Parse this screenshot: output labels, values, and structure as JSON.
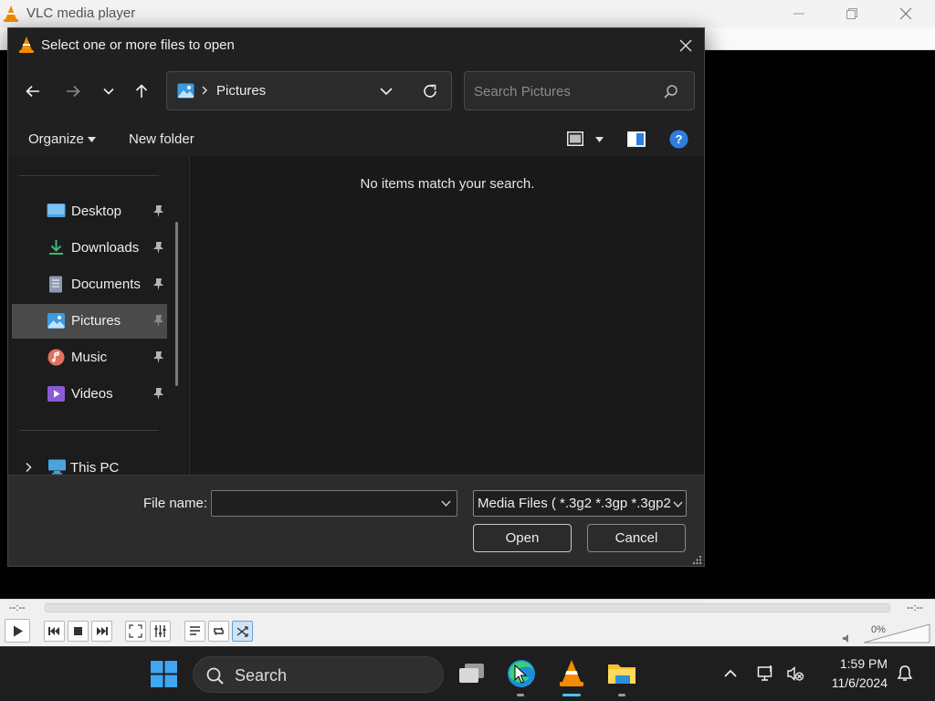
{
  "vlc": {
    "title": "VLC media player",
    "time_elapsed": "--:--",
    "time_remaining": "--:--",
    "volume_percent": "0%",
    "volume_level": 0,
    "controls": [
      "play-icon",
      "previous-icon",
      "stop-icon",
      "next-icon",
      "fullscreen-icon",
      "equalizer-icon",
      "playlist-icon",
      "loop-icon",
      "shuffle-icon"
    ]
  },
  "dialog": {
    "title": "Select one or more files to open",
    "address": {
      "current_folder": "Pictures"
    },
    "search": {
      "placeholder": "Search Pictures"
    },
    "commands": {
      "organize": "Organize",
      "new_folder": "New folder"
    },
    "nav_pane": {
      "items": [
        {
          "label": "Desktop",
          "icon": "desktop-icon",
          "pinned": true
        },
        {
          "label": "Downloads",
          "icon": "downloads-icon",
          "pinned": true
        },
        {
          "label": "Documents",
          "icon": "documents-icon",
          "pinned": true
        },
        {
          "label": "Pictures",
          "icon": "pictures-icon",
          "pinned": true,
          "selected": true
        },
        {
          "label": "Music",
          "icon": "music-icon",
          "pinned": true
        },
        {
          "label": "Videos",
          "icon": "videos-icon",
          "pinned": true
        }
      ],
      "this_pc": "This PC"
    },
    "content": {
      "empty_message": "No items match your search."
    },
    "footer": {
      "file_name_label": "File name:",
      "file_name_value": "",
      "file_type": "Media Files ( *.3g2 *.3gp *.3gp2",
      "open_label": "Open",
      "cancel_label": "Cancel"
    }
  },
  "taskbar": {
    "search_label": "Search",
    "apps": [
      "task-view-icon",
      "edge-icon",
      "vlc-icon",
      "file-explorer-icon"
    ],
    "time": "1:59 PM",
    "date": "11/6/2024"
  },
  "colors": {
    "dialog_bg": "#202020",
    "selection_bg": "#4a4a4a",
    "accent": "#4cc2ff",
    "vlc_orange": "#f28c00",
    "help_blue": "#2d7ee0"
  }
}
